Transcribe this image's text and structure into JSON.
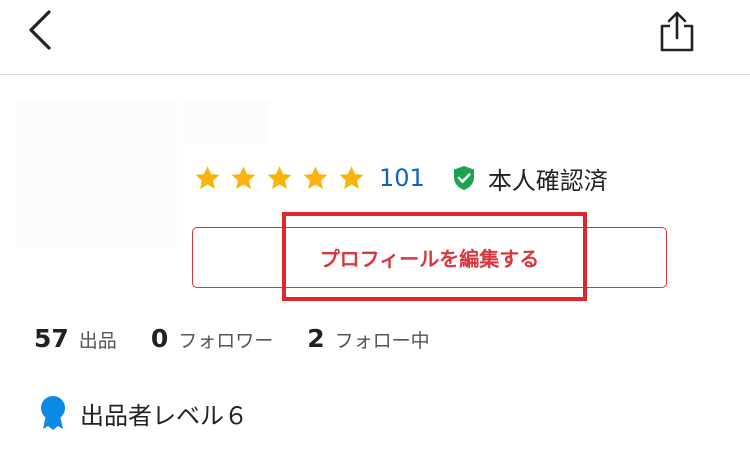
{
  "header": {
    "back_icon": "chevron-left-icon",
    "share_icon": "share-icon"
  },
  "profile": {
    "rating": {
      "stars": 5,
      "max_stars": 5,
      "count": "101",
      "star_color": "#f9b40b"
    },
    "verified": {
      "label": "本人確認済",
      "icon": "verified-shield-icon",
      "color": "#1aa351"
    },
    "edit_button_label": "プロフィールを編集する"
  },
  "stats": [
    {
      "number": "57",
      "label": "出品"
    },
    {
      "number": "0",
      "label": "フォロワー"
    },
    {
      "number": "2",
      "label": "フォロー中"
    }
  ],
  "level": {
    "label": "出品者レベル６",
    "icon": "badge-icon",
    "color": "#0b8ae6"
  },
  "colors": {
    "accent_red": "#d9363e",
    "highlight_red": "#e0262d",
    "link_blue": "#0b63c4"
  }
}
